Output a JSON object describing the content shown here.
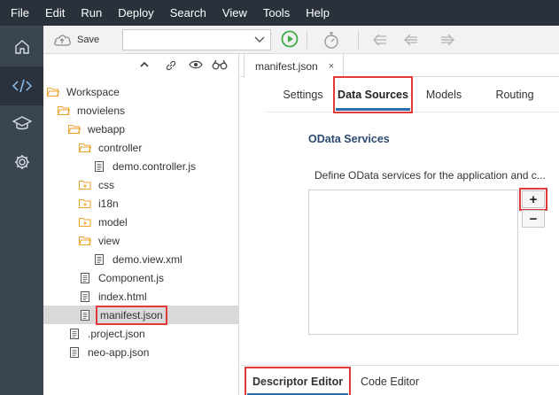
{
  "menu": {
    "items": [
      "File",
      "Edit",
      "Run",
      "Deploy",
      "Search",
      "View",
      "Tools",
      "Help"
    ]
  },
  "rail": {
    "icons": [
      "home-icon",
      "code-icon",
      "learning-icon",
      "settings-icon"
    ],
    "active": "code-icon"
  },
  "toolbar": {
    "save_label": "Save",
    "run_config_value": "",
    "run_color": "#3fae49"
  },
  "explorer": {
    "tree": [
      {
        "label": "Workspace",
        "type": "folder-open"
      },
      {
        "label": "movielens",
        "type": "folder-open"
      },
      {
        "label": "webapp",
        "type": "folder-open"
      },
      {
        "label": "controller",
        "type": "folder-open"
      },
      {
        "label": "demo.controller.js",
        "type": "file"
      },
      {
        "label": "css",
        "type": "folder"
      },
      {
        "label": "i18n",
        "type": "folder"
      },
      {
        "label": "model",
        "type": "folder"
      },
      {
        "label": "view",
        "type": "folder-open"
      },
      {
        "label": "demo.view.xml",
        "type": "file"
      },
      {
        "label": "Component.js",
        "type": "file"
      },
      {
        "label": "index.html",
        "type": "file"
      },
      {
        "label": "manifest.json",
        "type": "file",
        "selected": true
      },
      {
        "label": ".project.json",
        "type": "file"
      },
      {
        "label": "neo-app.json",
        "type": "file"
      }
    ]
  },
  "editor": {
    "tab_label": "manifest.json",
    "tab_close": "×",
    "subtabs": [
      "Settings",
      "Data Sources",
      "Models",
      "Routing"
    ],
    "active_subtab": "Data Sources",
    "section_title": "OData Services",
    "section_desc": "Define OData services for the application and c...",
    "add_label": "+",
    "remove_label": "−",
    "bottom_tabs": [
      "Descriptor Editor",
      "Code Editor"
    ],
    "active_bottom_tab": "Descriptor Editor"
  },
  "colors": {
    "menubar_bg": "#29313a",
    "rail_bg": "#3a4552",
    "accent": "#2b6cb0",
    "folder": "#f0a22e",
    "highlight": "#e03b3b"
  }
}
